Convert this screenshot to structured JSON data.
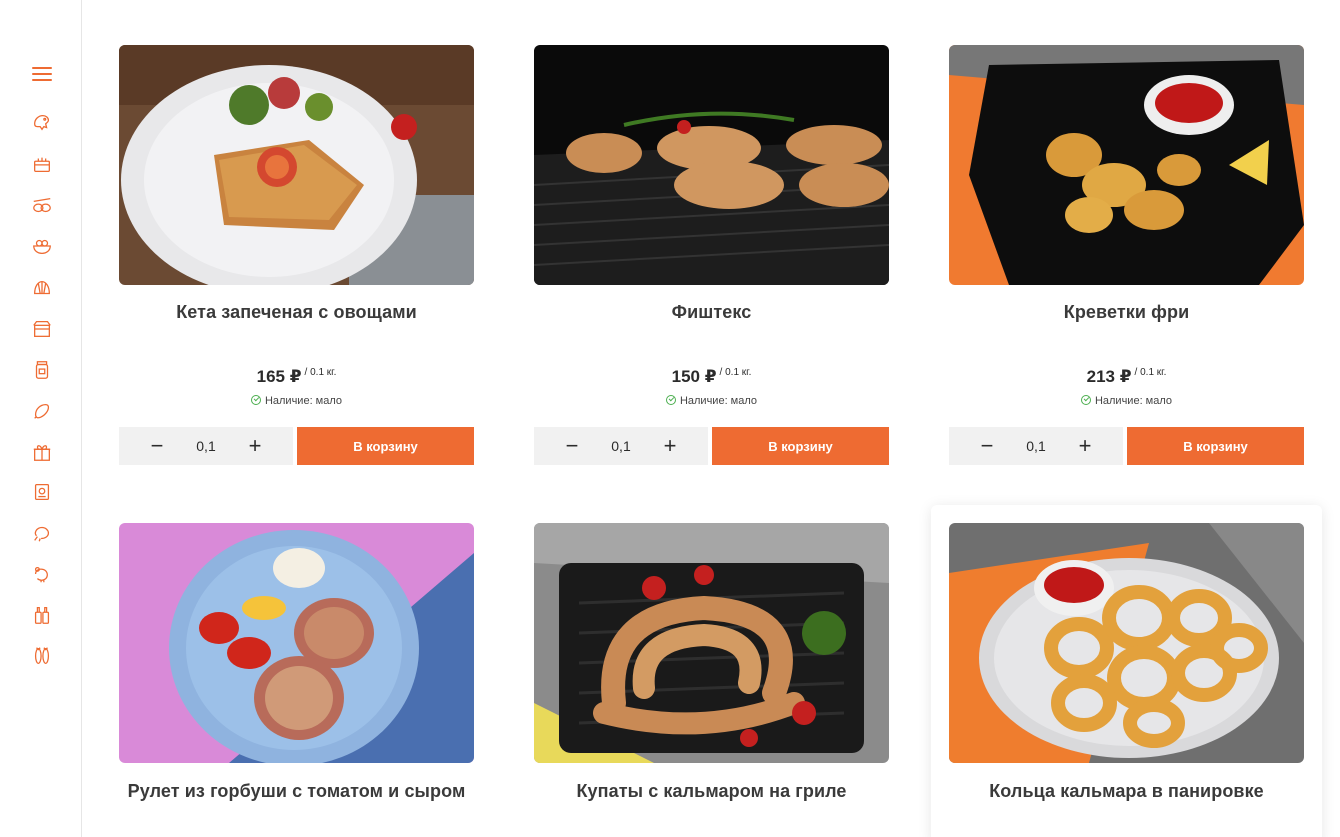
{
  "sidebar": {
    "icons": [
      "menu-icon",
      "poultry-icon",
      "box-icon",
      "sushi-icon",
      "salad-icon",
      "shell-icon",
      "bakery-icon",
      "jar-icon",
      "sausage-icon",
      "gift-icon",
      "grill-icon",
      "chicken-icon",
      "turkey-icon",
      "bottles-icon",
      "fish-icon"
    ]
  },
  "products": [
    {
      "title": "Кета запеченая с овощами",
      "price": "165 ₽",
      "unit": "/ 0.1 кг.",
      "availability": "Наличие: мало",
      "qty": "0,1",
      "button": "В корзину",
      "minus": "−",
      "plus": "+"
    },
    {
      "title": "Фиштекс",
      "price": "150 ₽",
      "unit": "/ 0.1 кг.",
      "availability": "Наличие: мало",
      "qty": "0,1",
      "button": "В корзину",
      "minus": "−",
      "plus": "+"
    },
    {
      "title": "Креветки фри",
      "price": "213 ₽",
      "unit": "/ 0.1 кг.",
      "availability": "Наличие: мало",
      "qty": "0,1",
      "button": "В корзину",
      "minus": "−",
      "plus": "+"
    },
    {
      "title": "Рулет из горбуши с томатом и сыром"
    },
    {
      "title": "Купаты с кальмаром на гриле"
    },
    {
      "title": "Кольца кальмара в панировке"
    }
  ],
  "colors": {
    "accent": "#ee6b32",
    "available": "#4caf50"
  }
}
